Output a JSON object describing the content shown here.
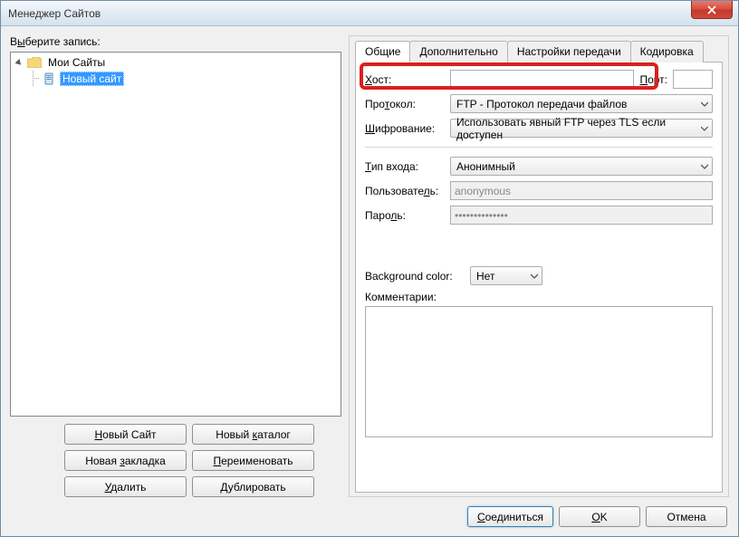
{
  "window": {
    "title": "Менеджер Сайтов"
  },
  "left": {
    "select_label_prefix": "В",
    "select_label_ul": "ы",
    "select_label_suffix": "берите запись:",
    "root": "Мои Сайты",
    "child": "Новый сайт",
    "buttons": {
      "new_site_pre": "",
      "new_site_ul": "Н",
      "new_site_post": "овый Сайт",
      "new_dir_pre": "Новый ",
      "new_dir_ul": "к",
      "new_dir_post": "аталог",
      "new_bm_pre": "Новая ",
      "new_bm_ul": "з",
      "new_bm_post": "акладка",
      "rename_pre": "",
      "rename_ul": "П",
      "rename_post": "ереименовать",
      "delete_pre": "",
      "delete_ul": "У",
      "delete_post": "далить",
      "dup_pre": "",
      "dup_ul": "Д",
      "dup_post": "ублировать"
    }
  },
  "tabs": [
    "Общие",
    "Дополнительно",
    "Настройки передачи",
    "Кодировка"
  ],
  "form": {
    "host_label_ul": "Х",
    "host_label_post": "ост:",
    "host_value": "",
    "port_label_pre": "",
    "port_label_ul": "П",
    "port_label_post": "орт:",
    "port_value": "",
    "proto_label_pre": "Про",
    "proto_label_ul": "т",
    "proto_label_post": "окол:",
    "proto_value": "FTP - Протокол передачи файлов",
    "enc_label_pre": "",
    "enc_label_ul": "Ш",
    "enc_label_post": "ифрование:",
    "enc_value": "Использовать явный FTP через TLS если доступен",
    "login_label_pre": "",
    "login_label_ul": "Т",
    "login_label_post": "ип входа:",
    "login_value": "Анонимный",
    "user_label_pre": "Пользовате",
    "user_label_ul": "л",
    "user_label_post": "ь:",
    "user_value": "anonymous",
    "pass_label_pre": "Паро",
    "pass_label_ul": "л",
    "pass_label_post": "ь:",
    "pass_value": "••••••••••••••",
    "bgcolor_label": "Background color:",
    "bgcolor_value": "Нет",
    "comments_label_pre": "Ко",
    "comments_label_ul": "м",
    "comments_label_post": "ментарии:",
    "comments_value": ""
  },
  "footer": {
    "connect_pre": "",
    "connect_ul": "С",
    "connect_post": "оединиться",
    "ok_pre": "",
    "ok_ul": "O",
    "ok_post": "K",
    "cancel": "Отмена"
  }
}
